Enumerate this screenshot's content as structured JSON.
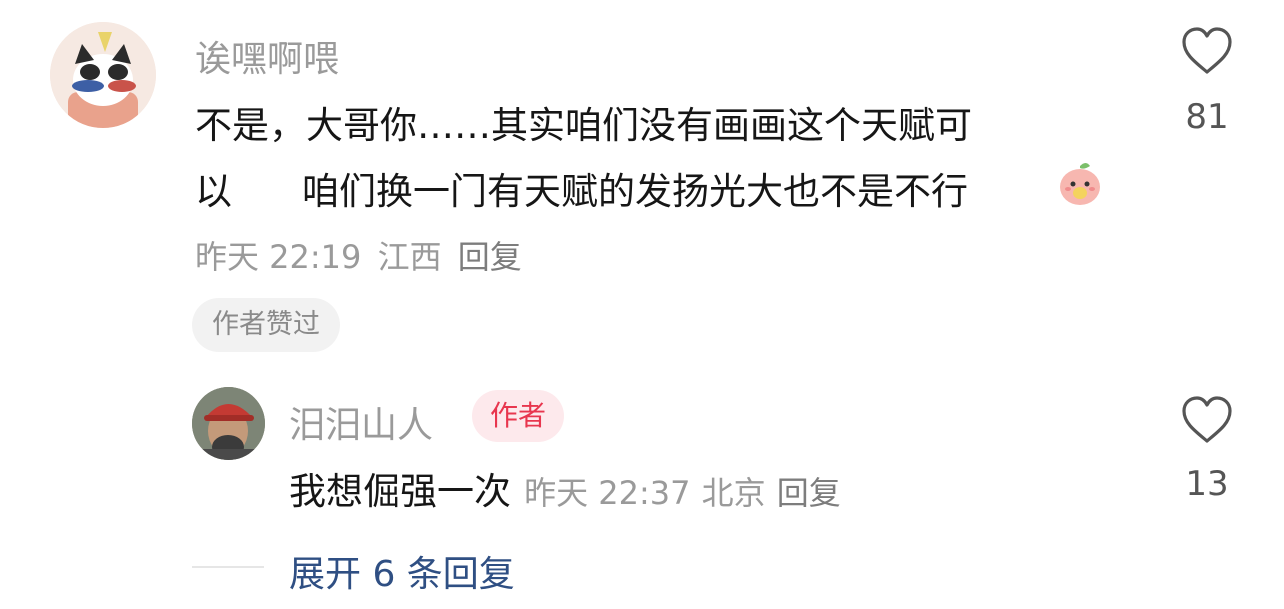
{
  "comment": {
    "username": "诶嘿啊喂",
    "text_line1": "不是，大哥你……其实咱们没有画画这个天赋可",
    "text_line2_a": "以",
    "text_line2_b": "咱们换一门有天赋的发扬光大也不是不行",
    "time": "昨天 22:19",
    "location": "江西",
    "reply_label": "回复",
    "author_liked": "作者赞过",
    "like_count": "81",
    "avatar_icon": "cat-avatar-icon",
    "emoji_icon": "peach-emoji-icon"
  },
  "reply": {
    "username": "汨汨山人",
    "badge": "作者",
    "text": "我想倔强一次",
    "time": "昨天 22:37",
    "location": "北京",
    "reply_label": "回复",
    "like_count": "13",
    "avatar_icon": "man-red-cap-avatar-icon"
  },
  "expand_replies": "展开 6 条回复",
  "colors": {
    "accent_link": "#2f4f83",
    "author_badge_bg": "#fde9ec",
    "author_badge_text": "#e8364e",
    "secondary_text": "#9a9a9a"
  }
}
